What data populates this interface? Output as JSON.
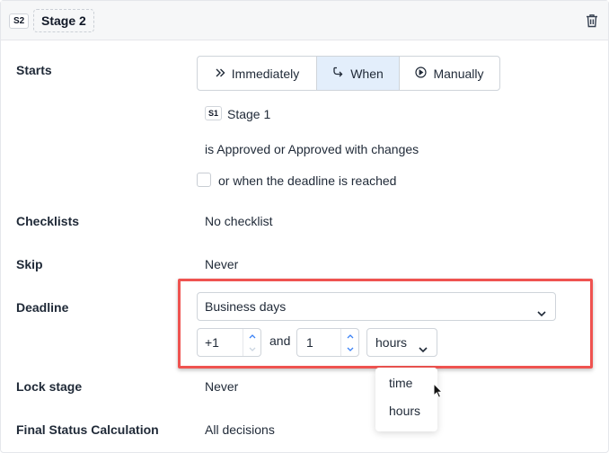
{
  "header": {
    "badge": "S2",
    "title": "Stage 2",
    "delete_icon": "trash-icon"
  },
  "starts": {
    "label": "Starts",
    "options": [
      {
        "label": "Immediately",
        "icon": "double-chevron-right-icon",
        "active": false
      },
      {
        "label": "When",
        "icon": "branch-icon",
        "active": true
      },
      {
        "label": "Manually",
        "icon": "play-circle-icon",
        "active": false
      }
    ],
    "stage_badge": "S1",
    "stage_name": "Stage 1",
    "condition": "is Approved or Approved with changes",
    "deadline_checkbox_label": "or when the deadline is reached",
    "deadline_checkbox_checked": false
  },
  "checklists": {
    "label": "Checklists",
    "value": "No checklist"
  },
  "skip": {
    "label": "Skip",
    "value": "Never"
  },
  "deadline": {
    "label": "Deadline",
    "type_value": "Business days",
    "days_value": "+1",
    "and_text": "and",
    "amount_value": "1",
    "unit_value": "hours",
    "unit_options": [
      "time",
      "hours"
    ]
  },
  "lock_stage": {
    "label": "Lock stage",
    "value": "Never"
  },
  "final_status": {
    "label": "Final Status Calculation",
    "value": "All decisions"
  },
  "colors": {
    "highlight": "#ef5350",
    "active_segment": "#e3eefb",
    "header_bg": "#f6f7f8",
    "arrow_blue": "#3b82f6"
  }
}
